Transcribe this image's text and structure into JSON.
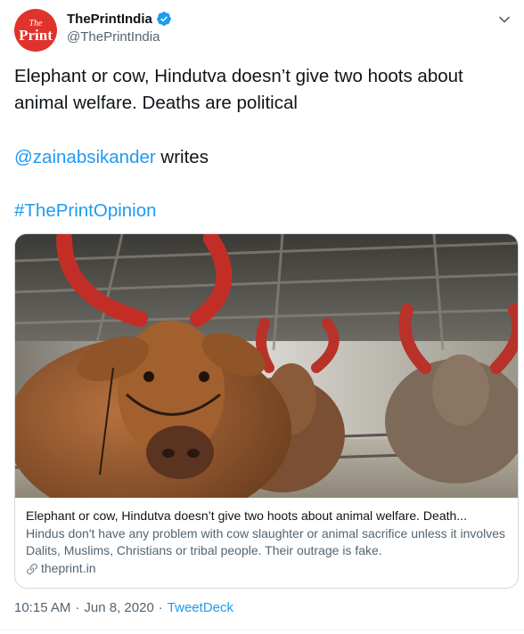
{
  "account": {
    "avatar_small": "The",
    "avatar_big": "Print",
    "display_name": "ThePrintIndia",
    "handle": "@ThePrintIndia"
  },
  "tweet": {
    "line1": "Elephant or cow, Hindutva doesn’t give two hoots about",
    "line2": "animal welfare. Deaths are political",
    "mention": "@zainabsikander",
    "mention_suffix": " writes",
    "hashtag": "#ThePrintOpinion"
  },
  "card": {
    "title": "Elephant or cow, Hindutva doesn’t give two hoots about animal welfare. Death...",
    "description": "Hindus don't have any problem with cow slaughter or animal sacrifice unless it involves Dalits, Muslims, Christians or tribal people. Their outrage is fake.",
    "domain": "theprint.in"
  },
  "meta": {
    "time": "10:15 AM",
    "separator1": "·",
    "date": "Jun 8, 2020",
    "separator2": "·",
    "source": "TweetDeck"
  },
  "icons": {
    "verified": "verified-badge-icon",
    "menu": "chevron-down-icon",
    "link": "link-icon"
  },
  "colors": {
    "brand_red": "#e0332b",
    "link_blue": "#1d9bf0",
    "secondary_text": "#536471"
  }
}
